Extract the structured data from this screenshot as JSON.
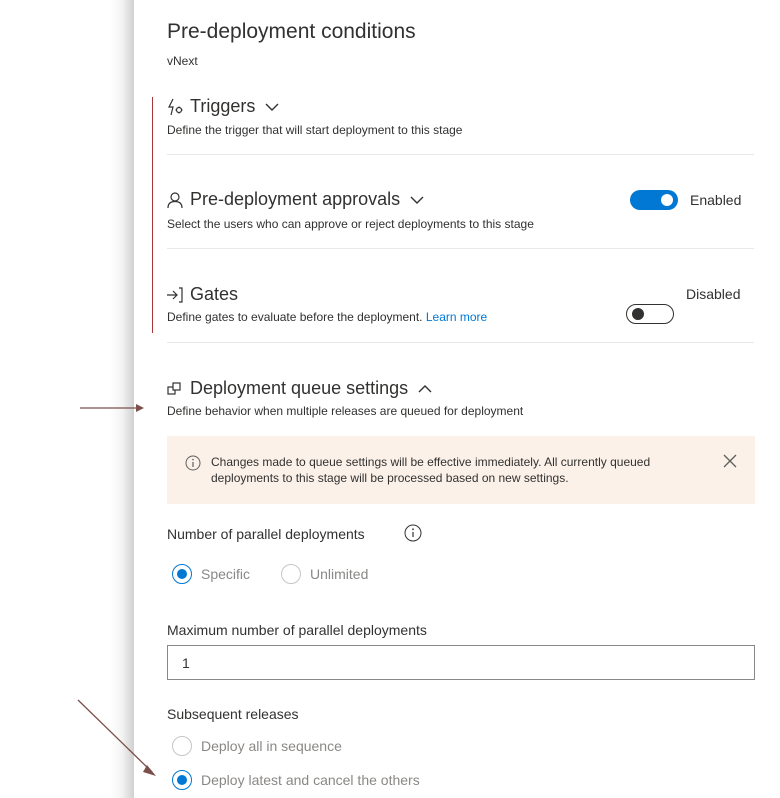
{
  "panel": {
    "title": "Pre-deployment conditions",
    "subtitle": "vNext"
  },
  "sections": {
    "triggers": {
      "title": "Triggers",
      "description": "Define the trigger that will start deployment to this stage",
      "icon": "lightning-gear-icon"
    },
    "approvals": {
      "title": "Pre-deployment approvals",
      "description": "Select the users who can approve or reject deployments to this stage",
      "icon": "person-icon",
      "toggle_state": "on",
      "toggle_label": "Enabled"
    },
    "gates": {
      "title": "Gates",
      "description": "Define gates to evaluate before the deployment.",
      "link": "Learn more",
      "icon": "arrow-into-bracket-icon",
      "toggle_state": "off",
      "toggle_label": "Disabled"
    },
    "queue": {
      "title": "Deployment queue settings",
      "description": "Define behavior when multiple releases are queued for deployment",
      "icon": "queue-icon",
      "expanded": true
    }
  },
  "info_banner": {
    "text": "Changes made to queue settings will be effective immediately. All currently queued deployments to this stage will be processed based on new settings.",
    "background": "#fbf1e9"
  },
  "parallel": {
    "label": "Number of parallel deployments",
    "options": [
      "Specific",
      "Unlimited"
    ],
    "selected": "Specific"
  },
  "max_parallel": {
    "label": "Maximum number of parallel deployments",
    "value": "1"
  },
  "subsequent": {
    "label": "Subsequent releases",
    "options": [
      "Deploy all in sequence",
      "Deploy latest and cancel the others"
    ],
    "selected": "Deploy latest and cancel the others"
  },
  "colors": {
    "accent": "#0078d4",
    "annotation": "#a4373a",
    "arrow": "#7b4f4a"
  }
}
